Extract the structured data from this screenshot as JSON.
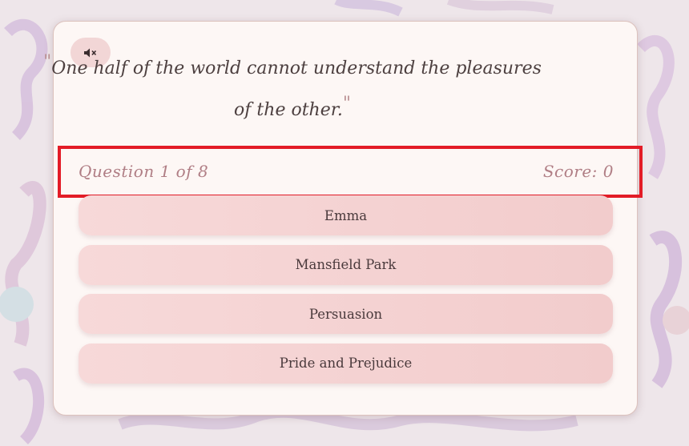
{
  "audio": {
    "mute_icon": "speaker-muted-icon"
  },
  "quote": {
    "open_mark": "\"",
    "text": "One half of the world cannot understand the pleasures of the other.",
    "close_mark": "\""
  },
  "quiz": {
    "question_counter": "Question 1 of 8",
    "score": "Score: 0",
    "answers": [
      "Emma",
      "Mansfield Park",
      "Persuasion",
      "Pride and Prejudice"
    ]
  },
  "colors": {
    "card": "#fdf7f5",
    "answer_button": "#f4d2d2",
    "accent_text": "#b07e85",
    "highlight_box": "#e31c27"
  }
}
